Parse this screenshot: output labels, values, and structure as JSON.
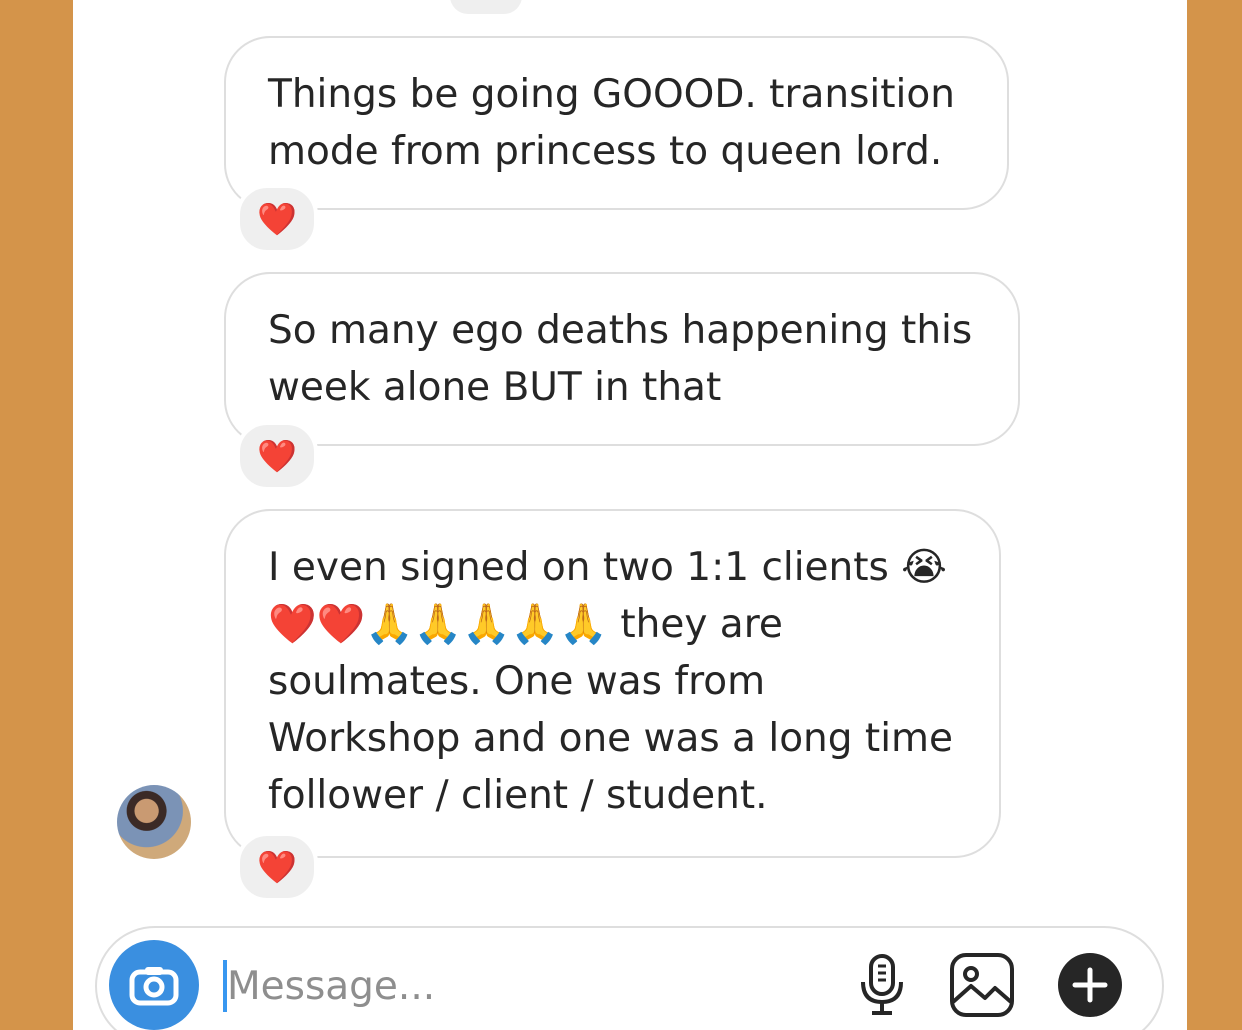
{
  "messages": [
    {
      "text": "Things be going GOOOD. transition\nmode from princess to queen lord.",
      "reaction": "❤️"
    },
    {
      "text": "So many ego deaths happening this\nweek alone BUT in that",
      "reaction": "❤️"
    },
    {
      "text": "I even signed on two 1:1 clients 😭\n❤️❤️🙏🙏🙏🙏🙏 they are\nsoulmates. One was from\nWorkshop and one was a long time\nfollower / client / student.",
      "reaction": "❤️"
    }
  ],
  "composer": {
    "placeholder": "Message...",
    "value": ""
  },
  "icons": {
    "camera": "camera-icon",
    "microphone": "microphone-icon",
    "gallery": "gallery-icon",
    "plus": "plus-icon"
  },
  "colors": {
    "background_frame": "#D4944A",
    "camera_button": "#3A8FE0",
    "bubble_border": "#dedede",
    "reaction_bg": "#efefef",
    "text": "#262626",
    "placeholder": "#8e8e8e"
  }
}
